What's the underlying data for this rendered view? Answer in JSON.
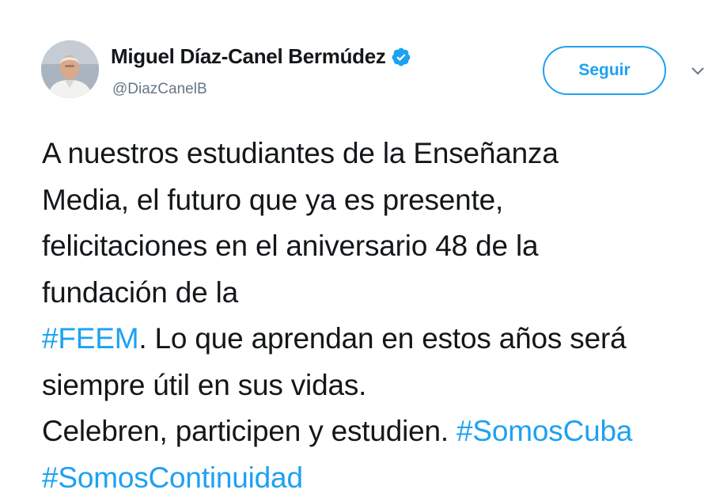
{
  "author": {
    "display_name": "Miguel Díaz-Canel Bermúdez",
    "handle": "@DiazCanelB",
    "verified": true
  },
  "follow_button": {
    "label": "Seguir"
  },
  "tweet": {
    "line1": "A nuestros estudiantes de la Enseñanza",
    "line2": "Media, el futuro que ya es presente,",
    "line3": "felicitaciones en el aniversario 48 de la",
    "line4": "fundación de la",
    "line5_hashtag": "#FEEM",
    "line5_text": ". Lo que aprendan en estos años será",
    "line6": "siempre útil en sus vidas.",
    "line7_text": "Celebren, participen y estudien. ",
    "line7_hashtag": "#SomosCuba",
    "line8_hashtag": "#SomosContinuidad"
  },
  "colors": {
    "accent": "#1da1f2",
    "text": "#14171a",
    "secondary_text": "#657786"
  },
  "icons": {
    "verified": "verified-badge-icon",
    "caret": "chevron-down-icon"
  }
}
